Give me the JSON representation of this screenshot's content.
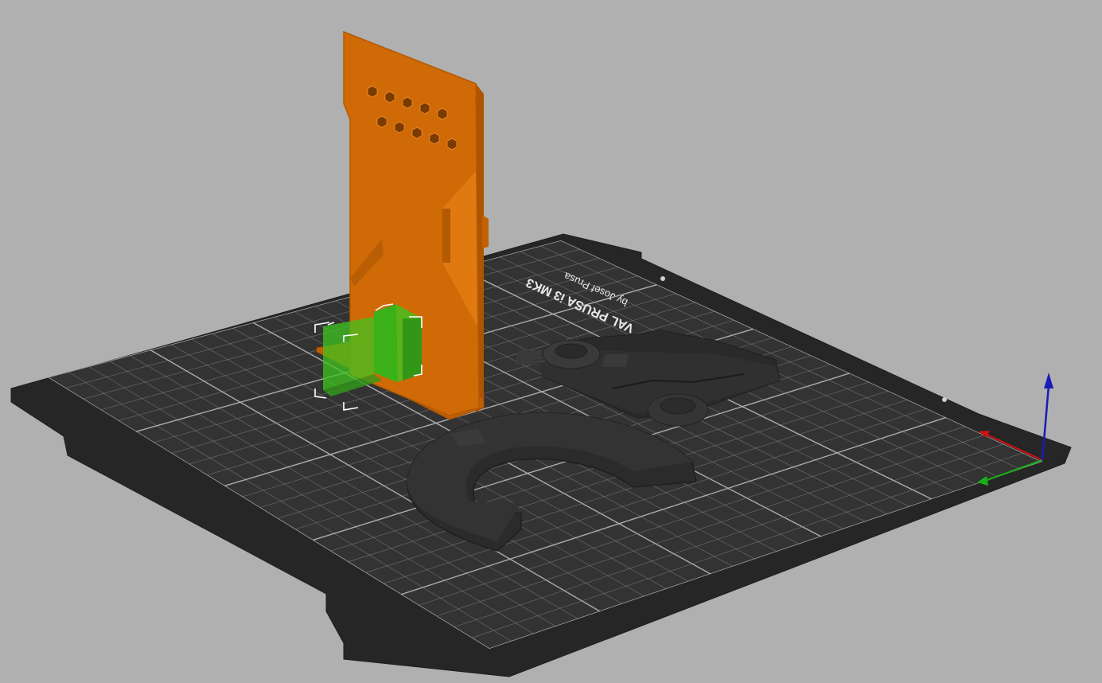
{
  "viewport": {
    "background_color": "#b0b0b0"
  },
  "bed": {
    "surface_color": "#2d2d2d",
    "grid_color": "#8a8a8a",
    "label_line1": "VAL PRUSA i3 MK3",
    "label_line2": "by Josef Prusa"
  },
  "objects": [
    {
      "name": "panel",
      "color": "#d26a05",
      "selected": true
    },
    {
      "name": "clip-part",
      "color": "#2f2f2f",
      "selected": false
    },
    {
      "name": "arc-part",
      "color": "#2f2f2f",
      "selected": false
    }
  ],
  "modifier": {
    "color": "#3fc41f",
    "selected": true
  },
  "axes": {
    "x_color": "#d01010",
    "y_color": "#19b019",
    "z_color": "#1a1ab8"
  }
}
